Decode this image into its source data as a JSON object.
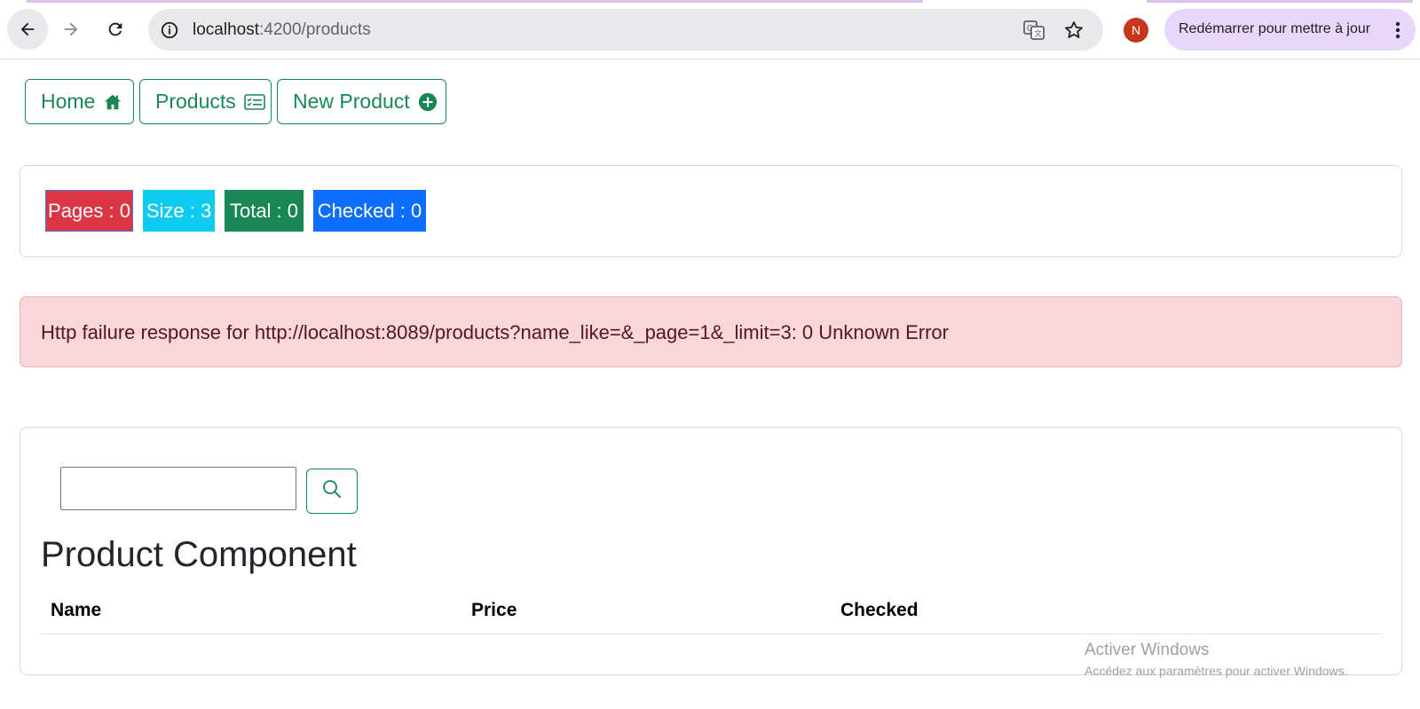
{
  "browser": {
    "url_host": "localhost",
    "url_path": ":4200/products",
    "profile_initial": "N",
    "update_label": "Redémarrer pour mettre à jour",
    "icons": {
      "back": "arrow-left-icon",
      "forward": "arrow-right-icon",
      "reload": "reload-icon",
      "site_info": "info-icon",
      "translate": "translate-icon",
      "bookmark": "star-icon",
      "menu": "kebab-menu-icon"
    }
  },
  "navbar": {
    "home_label": "Home",
    "products_label": "Products",
    "new_product_label": "New Product",
    "icons": {
      "home": "house-icon",
      "products": "card-checklist-icon",
      "new_product": "plus-circle-icon"
    }
  },
  "stats": {
    "pages": "Pages : 0",
    "size": "Size : 3",
    "total": "Total : 0",
    "checked": "Checked : 0"
  },
  "error": {
    "message": "Http failure response for http://localhost:8089/products?name_like=&_page=1&_limit=3: 0 Unknown Error"
  },
  "products": {
    "search_value": "",
    "search_icon": "search-icon",
    "title": "Product Component",
    "columns": [
      "Name",
      "Price",
      "Checked"
    ],
    "rows": []
  },
  "watermark": {
    "line1": "Activer Windows",
    "line2": "Accédez aux paramètres pour activer Windows."
  },
  "colors": {
    "primary_green": "#198754",
    "danger": "#dc3545",
    "info": "#0dcaf0",
    "blue": "#0d6efd",
    "alert_bg": "#f8d7da",
    "update_pill": "#e8d6fb"
  }
}
